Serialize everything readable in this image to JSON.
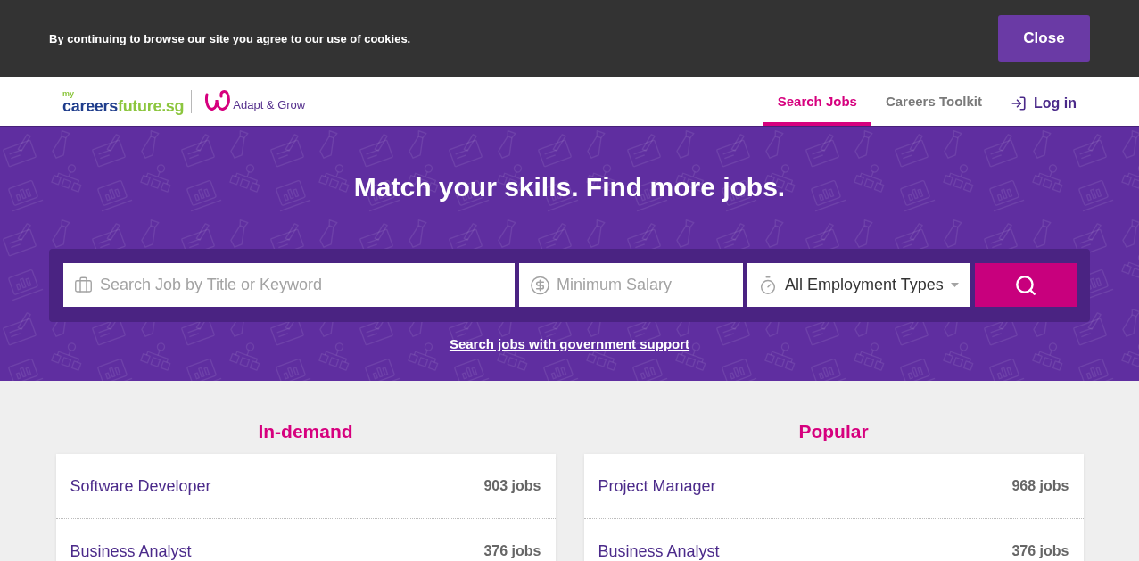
{
  "cookie_bar": {
    "message": "By continuing to browse our site you agree to our use of cookies.",
    "button": "Close"
  },
  "header": {
    "logo": {
      "prefix": "my",
      "name_first": "careers",
      "name_second": "future.sg",
      "partner": "Adapt & Grow"
    },
    "nav": [
      {
        "label": "Search Jobs",
        "selected": true
      },
      {
        "label": "Careers Toolkit",
        "selected": false
      }
    ],
    "login": {
      "label": "Log in"
    }
  },
  "hero": {
    "title": "Match your skills. Find more jobs.",
    "search": {
      "keyword": {
        "placeholder": "Search Job by Title or Keyword"
      },
      "salary": {
        "placeholder": "Minimum Salary"
      },
      "employment_type": {
        "value": "All Employment Types"
      }
    },
    "link": "Search jobs with government support"
  },
  "lists": [
    {
      "title": "In-demand",
      "items": [
        {
          "title": "Software Developer",
          "count": "903 jobs"
        },
        {
          "title": "Business Analyst",
          "count": "376 jobs"
        }
      ]
    },
    {
      "title": "Popular",
      "items": [
        {
          "title": "Project Manager",
          "count": "968 jobs"
        },
        {
          "title": "Business Analyst",
          "count": "376 jobs"
        }
      ]
    }
  ]
}
